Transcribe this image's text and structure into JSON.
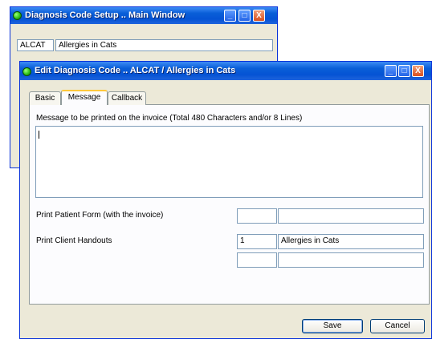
{
  "main_window": {
    "title": "Diagnosis Code Setup .. Main Window",
    "code_value": "ALCAT",
    "description_value": "Allergies in Cats"
  },
  "edit_window": {
    "title": "Edit Diagnosis Code .. ALCAT / Allergies in Cats",
    "tabs": [
      {
        "label": "Basic"
      },
      {
        "label": "Message"
      },
      {
        "label": "Callback"
      }
    ],
    "message_label": "Message to be printed on the invoice (Total 480 Characters and/or 8 Lines)",
    "message_value": "",
    "print_patient_form_label": "Print Patient Form (with the invoice)",
    "print_client_handouts_label": "Print Client Handouts",
    "patient_form_code": "",
    "patient_form_desc": "",
    "handout_1_code": "1",
    "handout_1_desc": "Allergies in Cats",
    "handout_2_code": "",
    "handout_2_desc": "",
    "save_label": "Save",
    "cancel_label": "Cancel"
  },
  "titlebar_buttons": {
    "minimize": "_",
    "maximize": "□",
    "close": "X"
  },
  "colors": {
    "titlebar": "#0553d4",
    "window_face": "#ece9d8",
    "close_button": "#d9501f",
    "active_tab_accent": "#ffc83c"
  },
  "icons": [
    "app-icon",
    "minimize-icon",
    "maximize-icon",
    "close-icon"
  ]
}
